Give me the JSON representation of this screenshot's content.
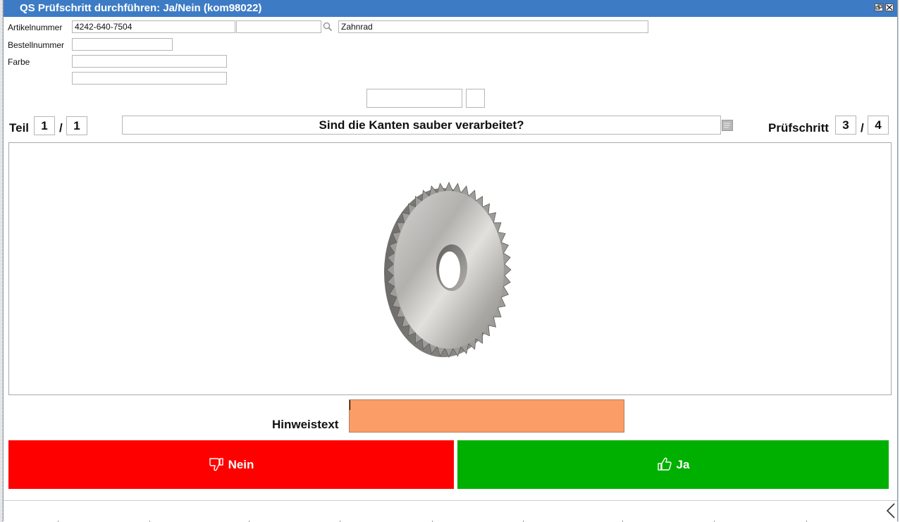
{
  "window": {
    "title": "QS Prüfschritt durchführen: Ja/Nein (kom98022)",
    "controls": [
      "restore-icon",
      "close-icon"
    ]
  },
  "form": {
    "artikelnummer_label": "Artikelnummer",
    "artikelnummer_value": "4242-640-7504",
    "artikelnummer_extra_value": "",
    "artikel_bezeichnung": "Zahnrad",
    "bestellnummer_label": "Bestellnummer",
    "bestellnummer_value": "",
    "farbe_label": "Farbe",
    "farbe_value": "",
    "farbe_value2": ""
  },
  "teil": {
    "label": "Teil",
    "current": "1",
    "separator": "/",
    "total": "1"
  },
  "question": "Sind die Kanten sauber verarbeitet?",
  "pruefschritt": {
    "label": "Prüfschritt",
    "current": "3",
    "separator": "/",
    "total": "4"
  },
  "hint": {
    "label": "Hinweistext",
    "value": "",
    "color": "#fb9d67"
  },
  "buttons": {
    "nein_label": "Nein",
    "nein_color": "#ff0000",
    "nein_icon": "thumbs-down-icon",
    "ja_label": "Ja",
    "ja_color": "#00b000",
    "ja_icon": "thumbs-up-icon"
  },
  "statusbar": {
    "collapse_icon": "chevron-left-icon"
  }
}
